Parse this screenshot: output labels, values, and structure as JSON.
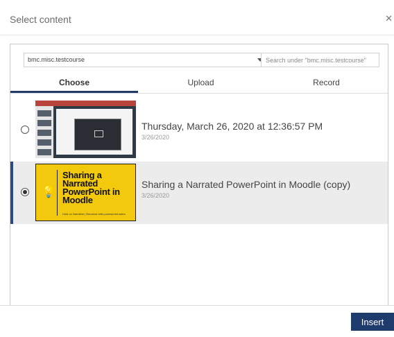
{
  "dialog": {
    "title": "Select content",
    "close_icon": "close-icon"
  },
  "filter": {
    "course_select_value": "bmc.misc.testcourse",
    "search_placeholder": "Search under \"bmc.misc.testcourse\""
  },
  "tabs": [
    {
      "label": "Choose",
      "active": true
    },
    {
      "label": "Upload",
      "active": false
    },
    {
      "label": "Record",
      "active": false
    }
  ],
  "media_items": [
    {
      "title": "Thursday, March 26, 2020 at 12:36:57 PM",
      "date": "3/26/2020",
      "selected": false,
      "thumbnail": "screen-recording-thumbnail"
    },
    {
      "title": "Sharing a Narrated PowerPoint in Moodle (copy)",
      "date": "3/26/2020",
      "selected": true,
      "thumbnail": "powerpoint-title-slide-thumbnail",
      "thumbnail_text": "Sharing a Narrated PowerPoint in Moodle"
    }
  ],
  "footer": {
    "insert_label": "Insert"
  },
  "colors": {
    "accent": "#1f3b6e",
    "selected_row_bg": "#ececec",
    "thumbnail_yellow": "#f2c90d"
  }
}
